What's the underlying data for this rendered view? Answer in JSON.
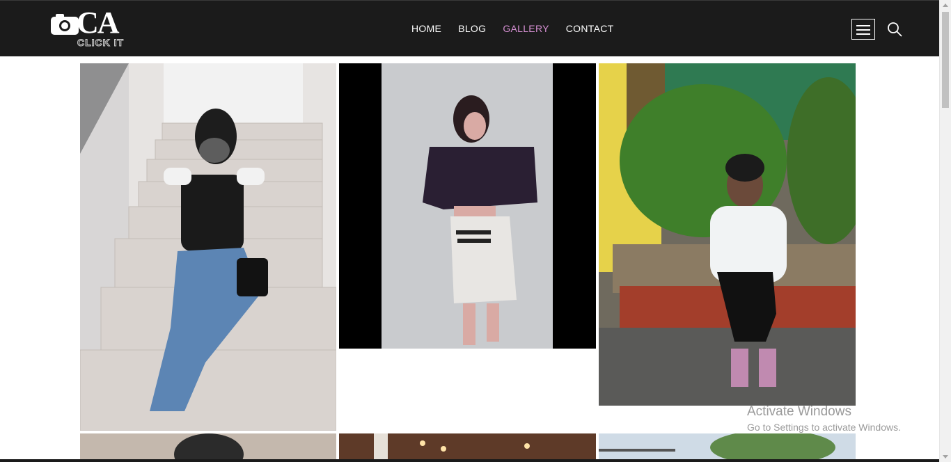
{
  "brand": {
    "logo_text": "CA",
    "logo_sub": "CLICK IT"
  },
  "nav": {
    "items": [
      {
        "label": "HOME",
        "active": false
      },
      {
        "label": "BLOG",
        "active": false
      },
      {
        "label": "GALLERY",
        "active": true
      },
      {
        "label": "CONTACT",
        "active": false
      }
    ],
    "active_color": "#d58fd2"
  },
  "icons": {
    "menu": "hamburger-menu-icon",
    "search": "search-icon",
    "logo": "camera-icon"
  },
  "gallery": {
    "photos": [
      {
        "subject": "woman-in-mask-sitting-on-stairs"
      },
      {
        "subject": "woman-posing-against-wall"
      },
      {
        "subject": "woman-sitting-by-garden"
      },
      {
        "subject": "portrait-partial"
      },
      {
        "subject": "interior-lights-partial"
      },
      {
        "subject": "outdoor-sky-partial"
      }
    ]
  },
  "watermark": {
    "title": "Activate Windows",
    "subtitle": "Go to Settings to activate Windows."
  },
  "colors": {
    "navbar_bg": "#1b1b1b",
    "page_bg": "#ffffff"
  }
}
